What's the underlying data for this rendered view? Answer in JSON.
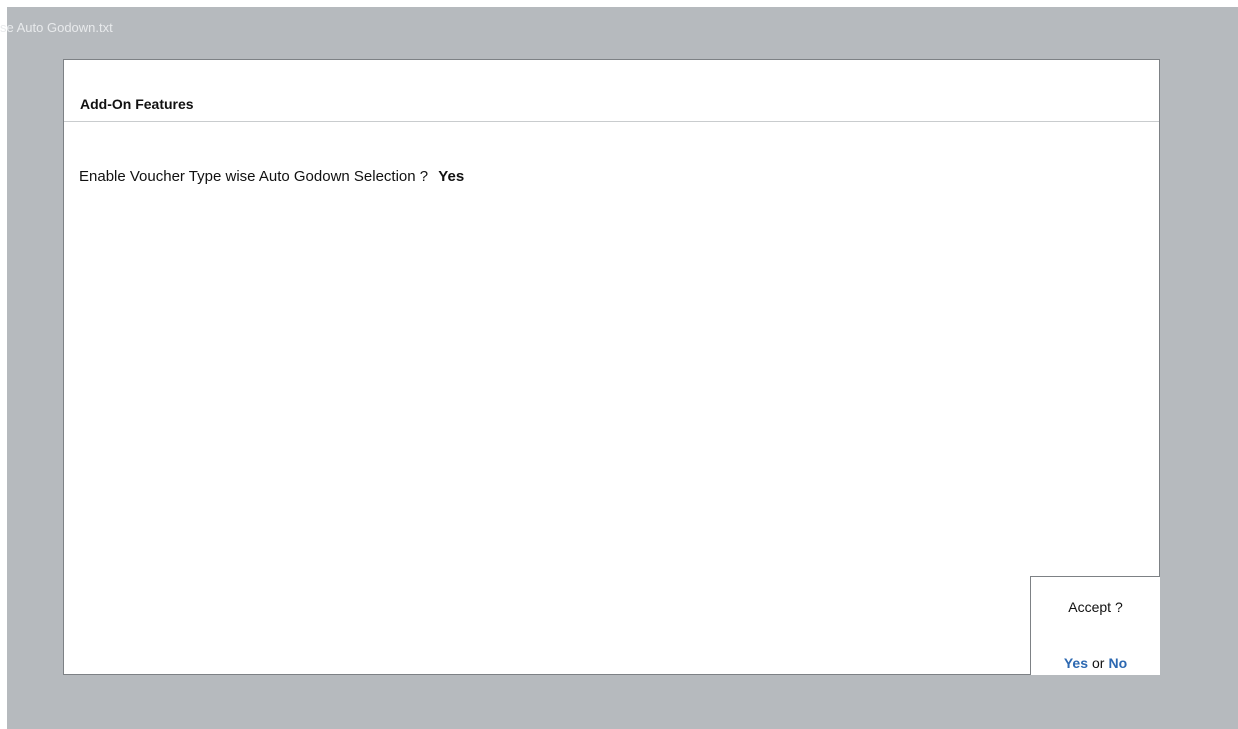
{
  "window": {
    "file_title": "se Auto Godown.txt"
  },
  "panel": {
    "title": "Add-On Features",
    "question": {
      "label": "Enable Voucher Type wise Auto Godown Selection ?",
      "value": "Yes"
    }
  },
  "accept_dialog": {
    "prompt": "Accept ?",
    "yes_label": "Yes",
    "or_label": "or",
    "no_label": "No"
  },
  "colors": {
    "backdrop": "#b6babe",
    "option_accent": "#2c68b1"
  }
}
